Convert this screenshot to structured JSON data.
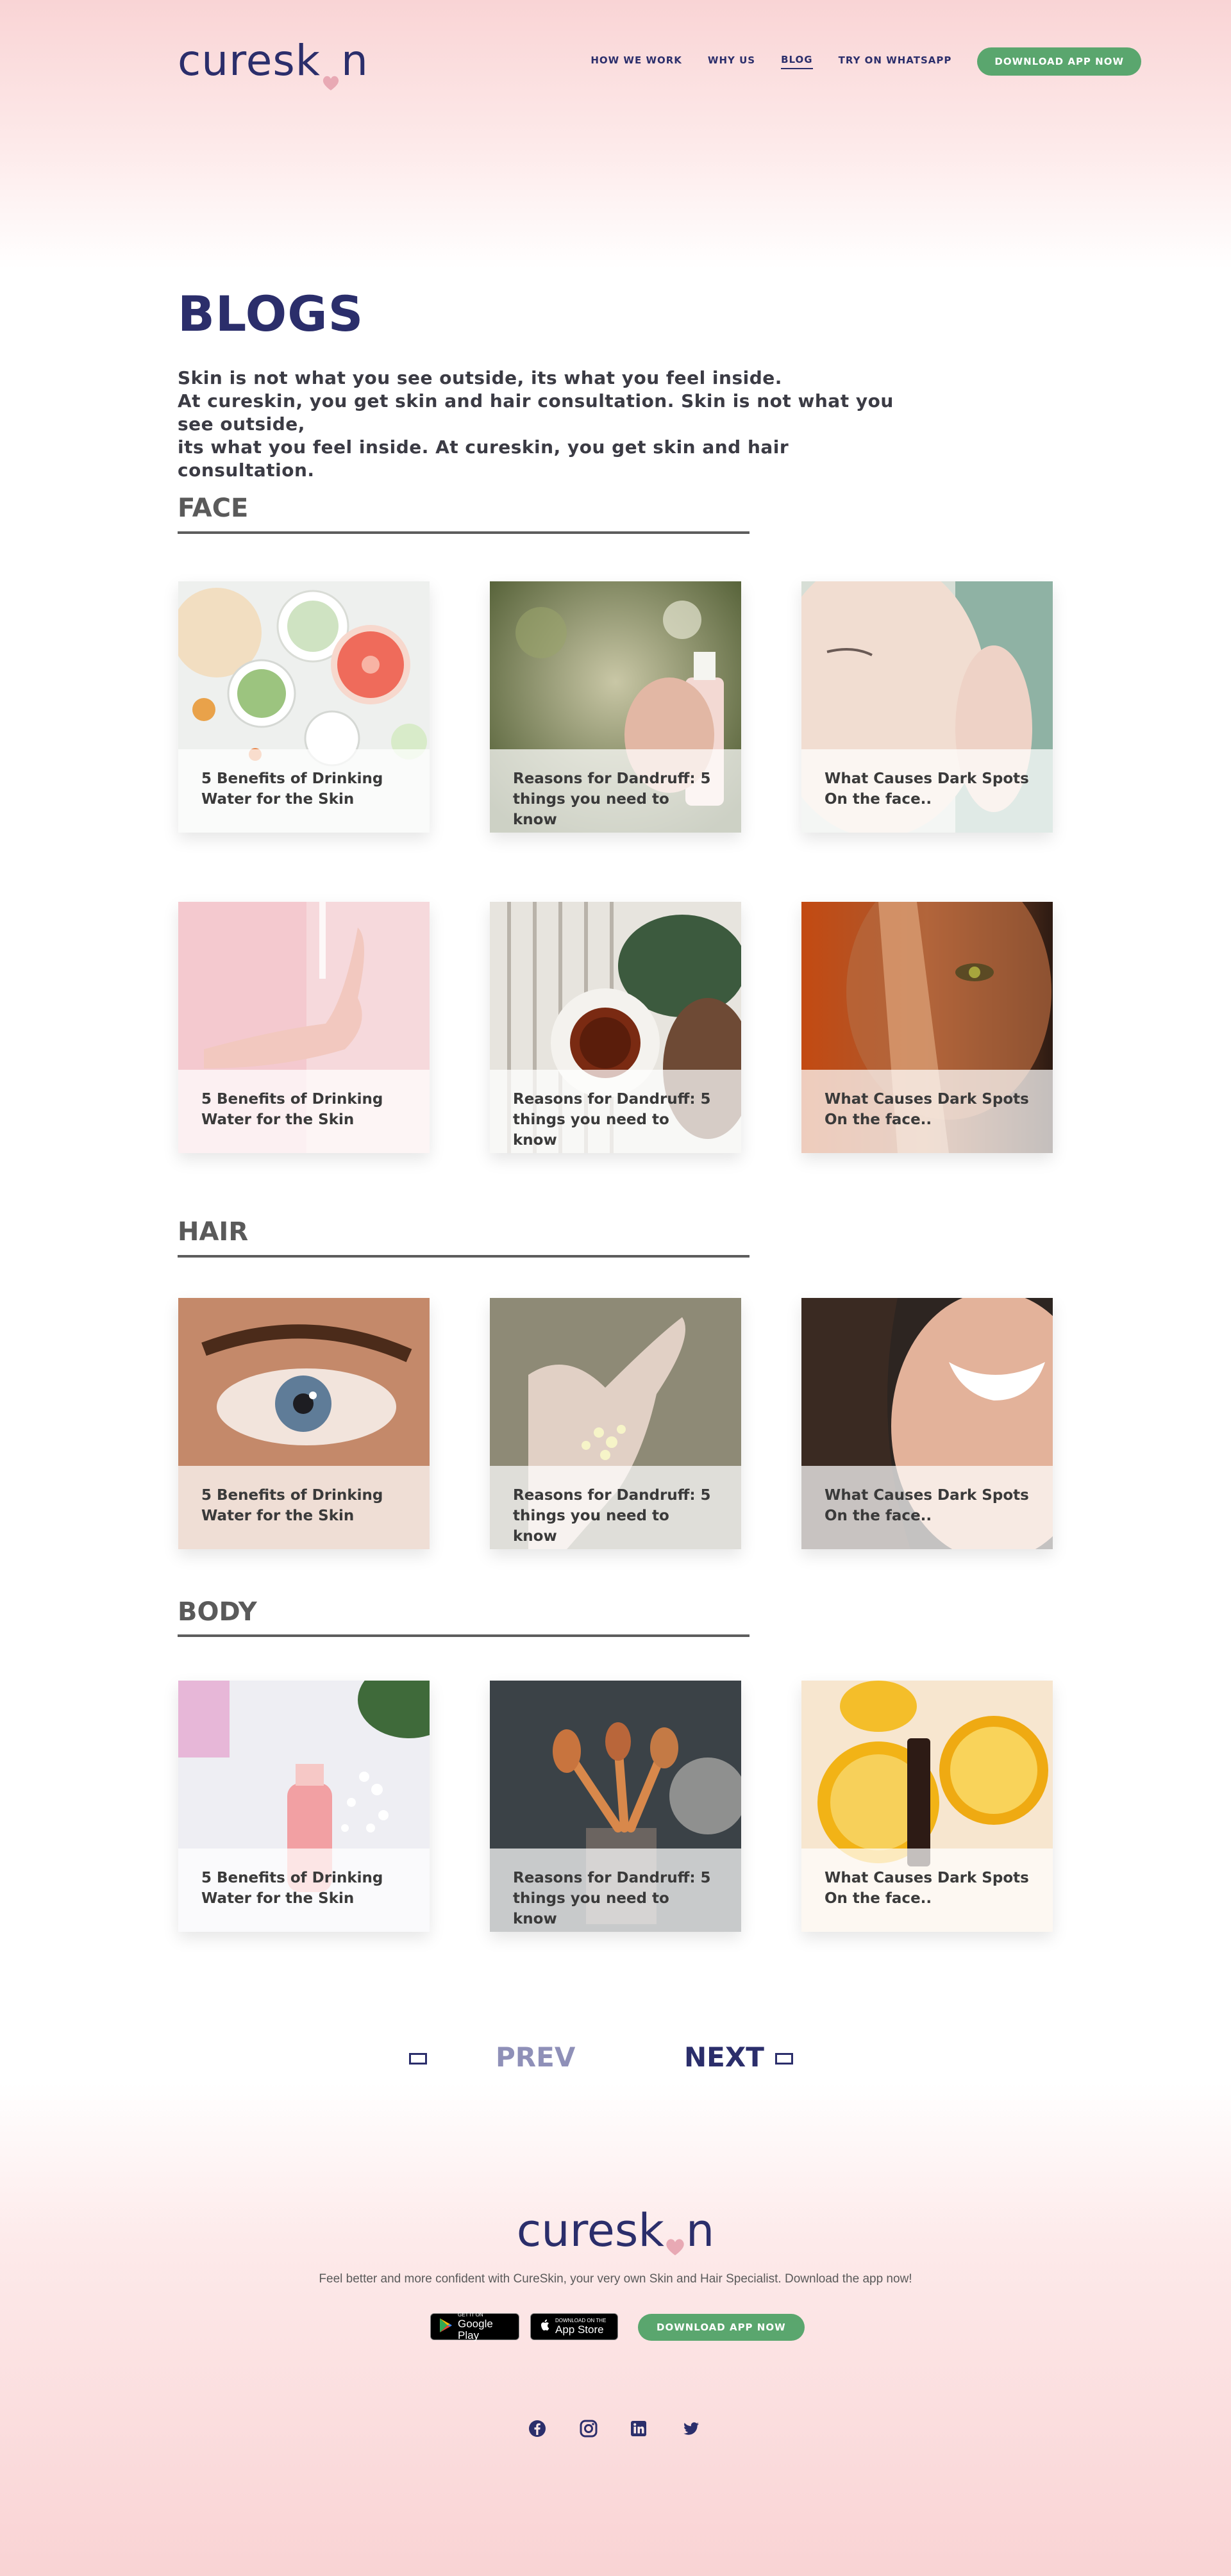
{
  "header": {
    "logo": "cureskin",
    "nav": [
      {
        "label": "HOW WE WORK"
      },
      {
        "label": "WHY US"
      },
      {
        "label": "BLOG",
        "active": true
      },
      {
        "label": "TRY ON WHATSAPP"
      }
    ],
    "cta": "DOWNLOAD APP NOW"
  },
  "intro": {
    "title": "BLOGS",
    "lines": [
      "Skin is not what you see outside, its what you feel inside.",
      "At cureskin, you get skin and hair consultation. Skin is not what you see outside,",
      "its what you feel inside. At cureskin, you get skin and hair consultation."
    ]
  },
  "sections": [
    {
      "title": "FACE",
      "cards": [
        {
          "title": "5 Benefits of Drinking Water for the Skin",
          "image": "grapefruit-glasses-photo"
        },
        {
          "title": "Reasons for Dandruff: 5 things you need to know",
          "image": "spray-bottle-photo"
        },
        {
          "title": "What Causes Dark Spots On the face..",
          "image": "woman-face-photo"
        },
        {
          "title": "5 Benefits of Drinking Water for the Skin",
          "image": "pink-hand-cream-photo"
        },
        {
          "title": "Reasons for Dandruff: 5 things you need to know",
          "image": "tea-cup-leaves-photo"
        },
        {
          "title": "What Causes Dark Spots On the face..",
          "image": "woman-eye-sunlight-photo"
        }
      ]
    },
    {
      "title": "HAIR",
      "cards": [
        {
          "title": "5 Benefits of Drinking Water for the Skin",
          "image": "blue-eye-closeup-photo"
        },
        {
          "title": "Reasons for Dandruff: 5 things you need to know",
          "image": "hand-flowers-photo"
        },
        {
          "title": "What Causes Dark Spots On the face..",
          "image": "smiling-woman-photo"
        }
      ]
    },
    {
      "title": "BODY",
      "cards": [
        {
          "title": "5 Benefits of Drinking Water for the Skin",
          "image": "pink-bottle-flowers-photo"
        },
        {
          "title": "Reasons for Dandruff: 5 things you need to know",
          "image": "makeup-brushes-photo"
        },
        {
          "title": "What Causes Dark Spots On the face..",
          "image": "lemons-lipstick-photo"
        }
      ]
    }
  ],
  "pager": {
    "prev": "PREV",
    "next": "NEXT"
  },
  "footer": {
    "logo": "cureskin",
    "tagline": "Feel better and more confident with CureSkin,  your very own  Skin and Hair Specialist. Download the app now!",
    "google_play": {
      "small": "GET IT ON",
      "big": "Google Play"
    },
    "app_store": {
      "small": "Download on the",
      "big": "App Store"
    },
    "cta": "DOWNLOAD APP NOW",
    "social": [
      "facebook-icon",
      "instagram-icon",
      "linkedin-icon",
      "twitter-icon"
    ]
  },
  "colors": {
    "brand": "#2b2e6b",
    "green": "#5aa66e",
    "pink": "#f9d4d5",
    "heart": "#e8a9b4"
  }
}
